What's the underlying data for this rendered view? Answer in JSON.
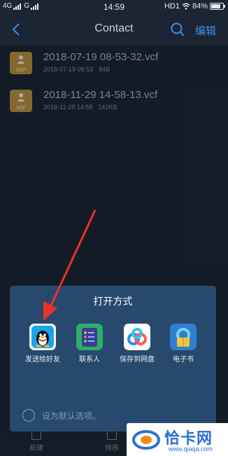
{
  "status_bar": {
    "network_left": "4G",
    "network_left2": "G",
    "time": "14:59",
    "hd": "HD1",
    "battery": "84%",
    "battery_level": 0.84
  },
  "header": {
    "title": "Contact",
    "edit_label": "编辑",
    "back_icon": "back-arrow-icon",
    "search_icon": "search-icon"
  },
  "files": [
    {
      "icon_label": "VCF",
      "name": "2018-07-19 08-53-32.vcf",
      "date": "2018-07-19 08:53",
      "size": "94B"
    },
    {
      "icon_label": "VCF",
      "name": "2018-11-29 14-58-13.vcf",
      "date": "2018-11-29 14:58",
      "size": "142KB"
    }
  ],
  "open_with": {
    "title": "打开方式",
    "apps": [
      {
        "name": "发送给好友",
        "icon": "qq-icon"
      },
      {
        "name": "联系人",
        "icon": "contacts-icon"
      },
      {
        "name": "保存到网盘",
        "icon": "baidu-netdisk-icon"
      },
      {
        "name": "电子书",
        "icon": "ebook-icon"
      }
    ],
    "default_option": "设为默认选项。"
  },
  "toolbar": {
    "items": [
      {
        "label": "新建"
      },
      {
        "label": "排序"
      }
    ]
  },
  "watermark": {
    "text": "恰卡网",
    "url": "www.qiaqa.com"
  },
  "colors": {
    "background": "#1a2432",
    "sheet": "#27496e",
    "accent": "#3d8fe6",
    "vcf_icon": "#c89a3e",
    "arrow": "#e8332a"
  }
}
